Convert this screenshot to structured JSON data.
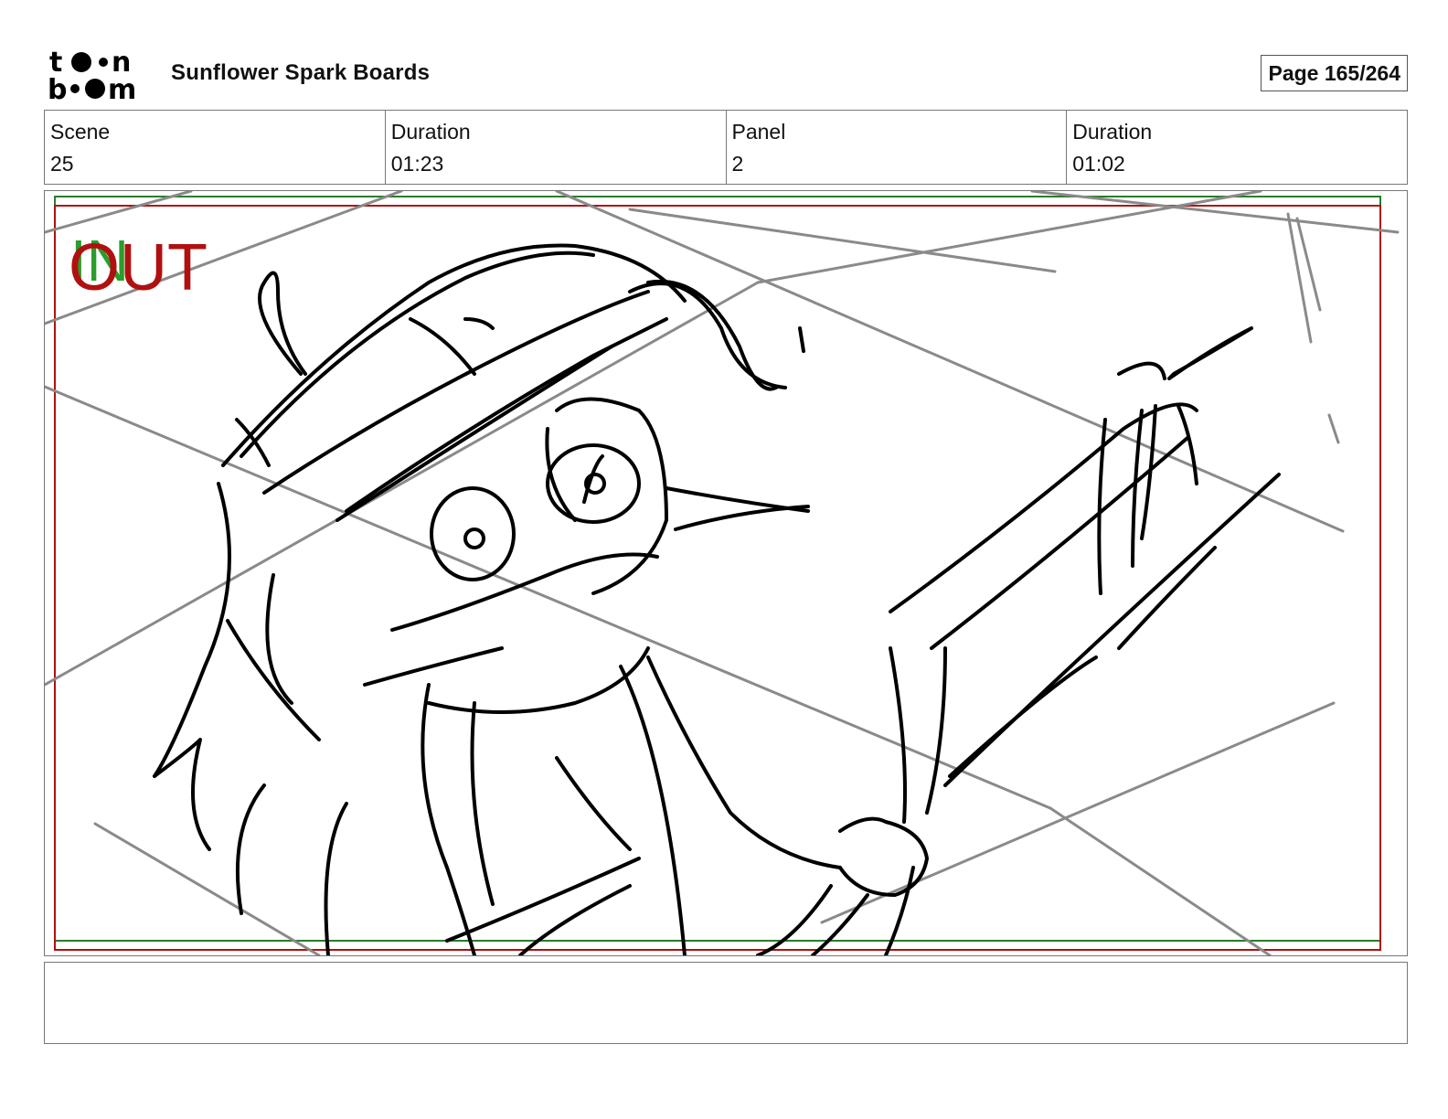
{
  "header": {
    "logo_alt": "toon boom",
    "project_title": "Sunflower Spark Boards",
    "page_indicator": "Page 165/264"
  },
  "info": {
    "scene_label": "Scene",
    "scene_value": "25",
    "scene_duration_label": "Duration",
    "scene_duration_value": "01:23",
    "panel_label": "Panel",
    "panel_value": "2",
    "panel_duration_label": "Duration",
    "panel_duration_value": "01:02"
  },
  "panel": {
    "in_marker": "IN",
    "out_marker": "OUT",
    "in_color": "#2a9d2a",
    "out_color": "#b01010",
    "sketch_icon": "character-sketch-icon"
  },
  "notes": {
    "text": ""
  }
}
